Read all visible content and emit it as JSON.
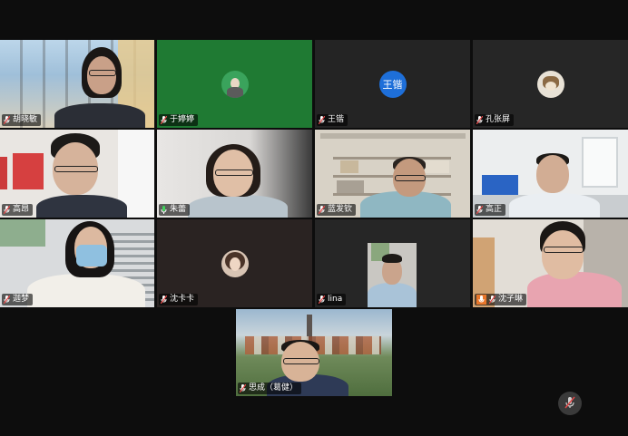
{
  "participants": [
    {
      "id": "p1",
      "name": "胡晓敏",
      "mic": "muted"
    },
    {
      "id": "p2",
      "name": "于婷婷",
      "mic": "muted"
    },
    {
      "id": "p3",
      "name": "王锴",
      "mic": "muted",
      "avatar_text": "王锴"
    },
    {
      "id": "p4",
      "name": "孔张屏",
      "mic": "muted"
    },
    {
      "id": "p5",
      "name": "高昂",
      "mic": "muted"
    },
    {
      "id": "p6",
      "name": "朱蕾",
      "mic": "speaking"
    },
    {
      "id": "p7",
      "name": "蓝发钦",
      "mic": "muted",
      "active": true
    },
    {
      "id": "p8",
      "name": "高正",
      "mic": "muted"
    },
    {
      "id": "p9",
      "name": "迦梦",
      "mic": "muted"
    },
    {
      "id": "p10",
      "name": "沈卡卡",
      "mic": "muted"
    },
    {
      "id": "p11",
      "name": "lina",
      "mic": "muted"
    },
    {
      "id": "p12",
      "name": "沈子琳",
      "mic": "muted",
      "badge": "orange"
    },
    {
      "id": "p13",
      "name": "思成（葛健）",
      "mic": "muted"
    }
  ],
  "colors": {
    "active_border": "#2fbf5a",
    "avatar_blue": "#1e6fd9",
    "mic_muted": "#e04848",
    "mic_speaking": "#3fd05a"
  },
  "controls": {
    "bottom_right_icon": "mic-muted-icon"
  }
}
